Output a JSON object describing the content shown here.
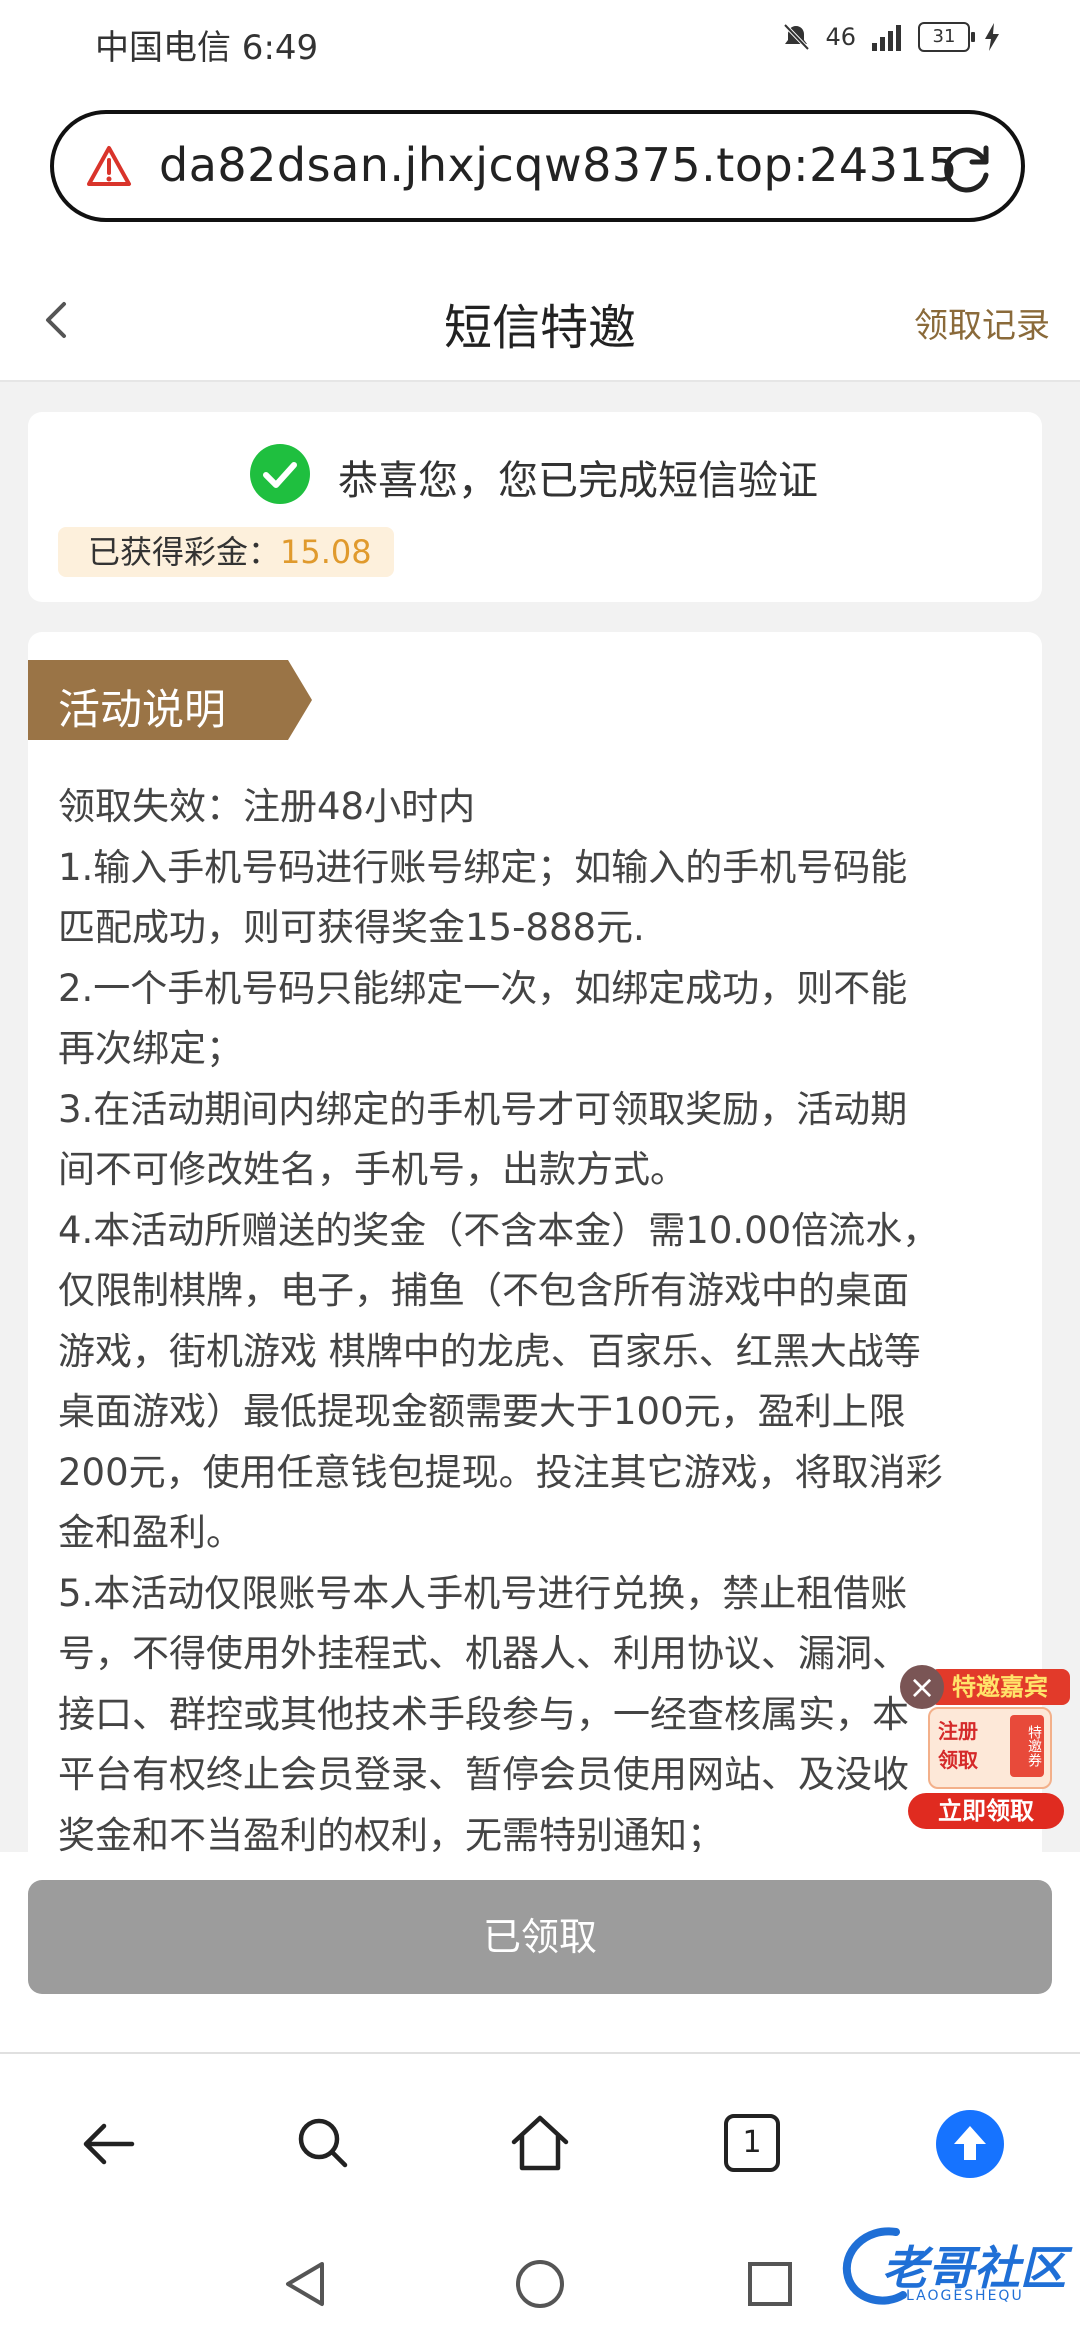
{
  "status_bar": {
    "carrier_time": "中国电信 6:49",
    "network": "46",
    "battery": "31"
  },
  "address_bar": {
    "url": "da82dsan.jhxjcqw8375.top:24315"
  },
  "header": {
    "title": "短信特邀",
    "record_link": "领取记录"
  },
  "success_card": {
    "message": "恭喜您，您已完成短信验证",
    "prize_label": "已获得彩金：",
    "prize_amount": "15.08"
  },
  "activity": {
    "ribbon_label": "活动说明",
    "rules": [
      "领取失效：注册48小时内",
      "1.输入手机号码进行账号绑定；如输入的手机号码能",
      "匹配成功，则可获得奖金15-888元.",
      "2.一个手机号码只能绑定一次，如绑定成功，则不能",
      "再次绑定；",
      "3.在活动期间内绑定的手机号才可领取奖励，活动期",
      "间不可修改姓名，手机号，出款方式。",
      "4.本活动所赠送的奖金（不含本金）需10.00倍流水，",
      "仅限制棋牌，电子，捕鱼（不包含所有游戏中的桌面",
      "游戏，街机游戏 棋牌中的龙虎、百家乐、红黑大战等",
      "桌面游戏）最低提现金额需要大于100元，盈利上限",
      "200元，使用任意钱包提现。投注其它游戏，将取消彩",
      "金和盈利。",
      "5.本活动仅限账号本人手机号进行兑换，禁止租借账",
      "号，不得使用外挂程式、机器人、利用协议、漏洞、",
      "接口、群控或其他技术手段参与，一经查核属实，本",
      "平台有权终止会员登录、暂停会员使用网站、及没收",
      "奖金和不当盈利的权利，无需特别通知；"
    ]
  },
  "promo": {
    "close": "×",
    "head": "特邀嘉宾",
    "line1": "注册",
    "line2": "领取",
    "tag": "特邀券",
    "button": "立即领取"
  },
  "claim_button": "已领取",
  "browser_toolbar": {
    "tabs_count": "1"
  },
  "watermark": {
    "text": "老哥社区",
    "sub": "LAOGESHEQU"
  },
  "colors": {
    "accent_brown": "#8a6a3a",
    "ribbon": "#9a7446",
    "success_green": "#1fbf3f",
    "prize_orange": "#e09a2d",
    "claimed_gray": "#9c9c9c",
    "browser_blue": "#1673ff"
  }
}
